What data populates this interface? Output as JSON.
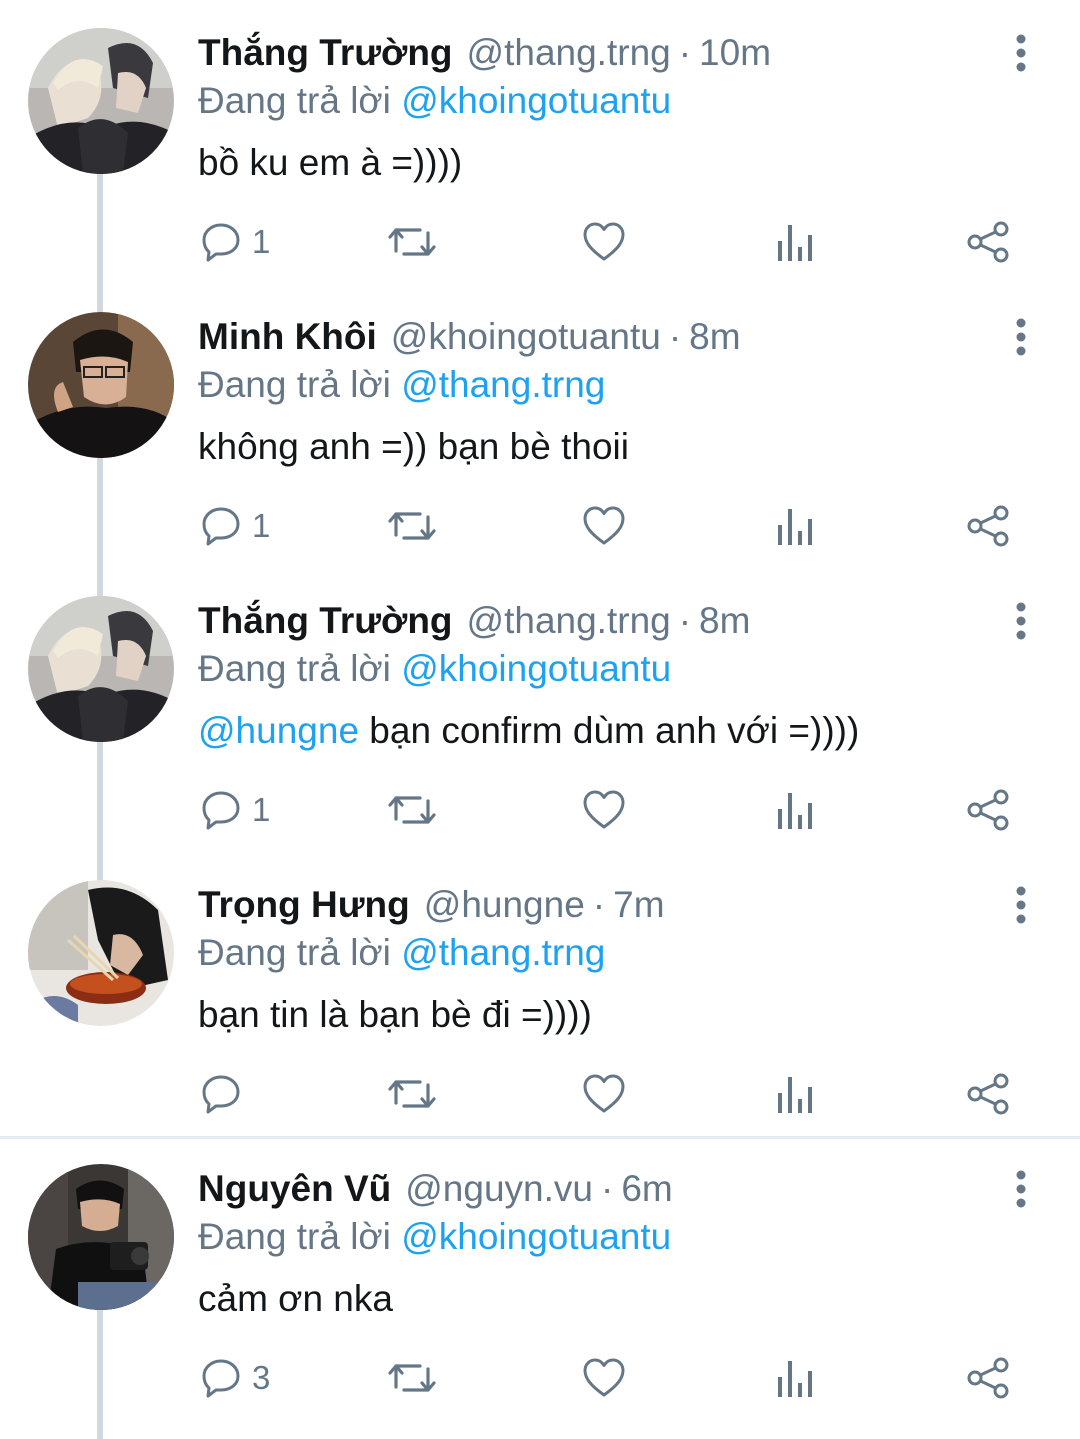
{
  "colors": {
    "accent": "#1da1f2",
    "secondary_text": "#657786",
    "primary_text": "#14171a",
    "thread_line": "#cfd9de",
    "divider": "#e6ecf0"
  },
  "tweets": [
    {
      "name": "Thắng Trường",
      "handle": "@thang.trng",
      "separator": "·",
      "time": "10m",
      "reply_prefix": "Đang trả lời",
      "reply_to": "@khoingotuantu",
      "text": "bồ ku em à =))))",
      "mention": "",
      "reply_count": "1",
      "avatar_icon": "avatar-thang-truong"
    },
    {
      "name": "Minh Khôi",
      "handle": "@khoingotuantu",
      "separator": "·",
      "time": "8m",
      "reply_prefix": "Đang trả lời",
      "reply_to": "@thang.trng",
      "text": "không anh =)) bạn bè thoii",
      "mention": "",
      "reply_count": "1",
      "avatar_icon": "avatar-minh-khoi"
    },
    {
      "name": "Thắng Trường",
      "handle": "@thang.trng",
      "separator": "·",
      "time": "8m",
      "reply_prefix": "Đang trả lời",
      "reply_to": "@khoingotuantu",
      "text": " bạn confirm dùm anh với =))))",
      "mention": "@hungne",
      "reply_count": "1",
      "avatar_icon": "avatar-thang-truong"
    },
    {
      "name": "Trọng Hưng",
      "handle": "@hungne",
      "separator": "·",
      "time": "7m",
      "reply_prefix": "Đang trả lời",
      "reply_to": "@thang.trng",
      "text": "bạn tin là bạn bè đi =))))",
      "mention": "",
      "reply_count": "",
      "avatar_icon": "avatar-trong-hung"
    },
    {
      "name": "Nguyên Vũ",
      "handle": "@nguyn.vu",
      "separator": "·",
      "time": "6m",
      "reply_prefix": "Đang trả lời",
      "reply_to": "@khoingotuantu",
      "text": "cảm ơn nka",
      "mention": "",
      "reply_count": "3",
      "avatar_icon": "avatar-nguyen-vu"
    }
  ]
}
